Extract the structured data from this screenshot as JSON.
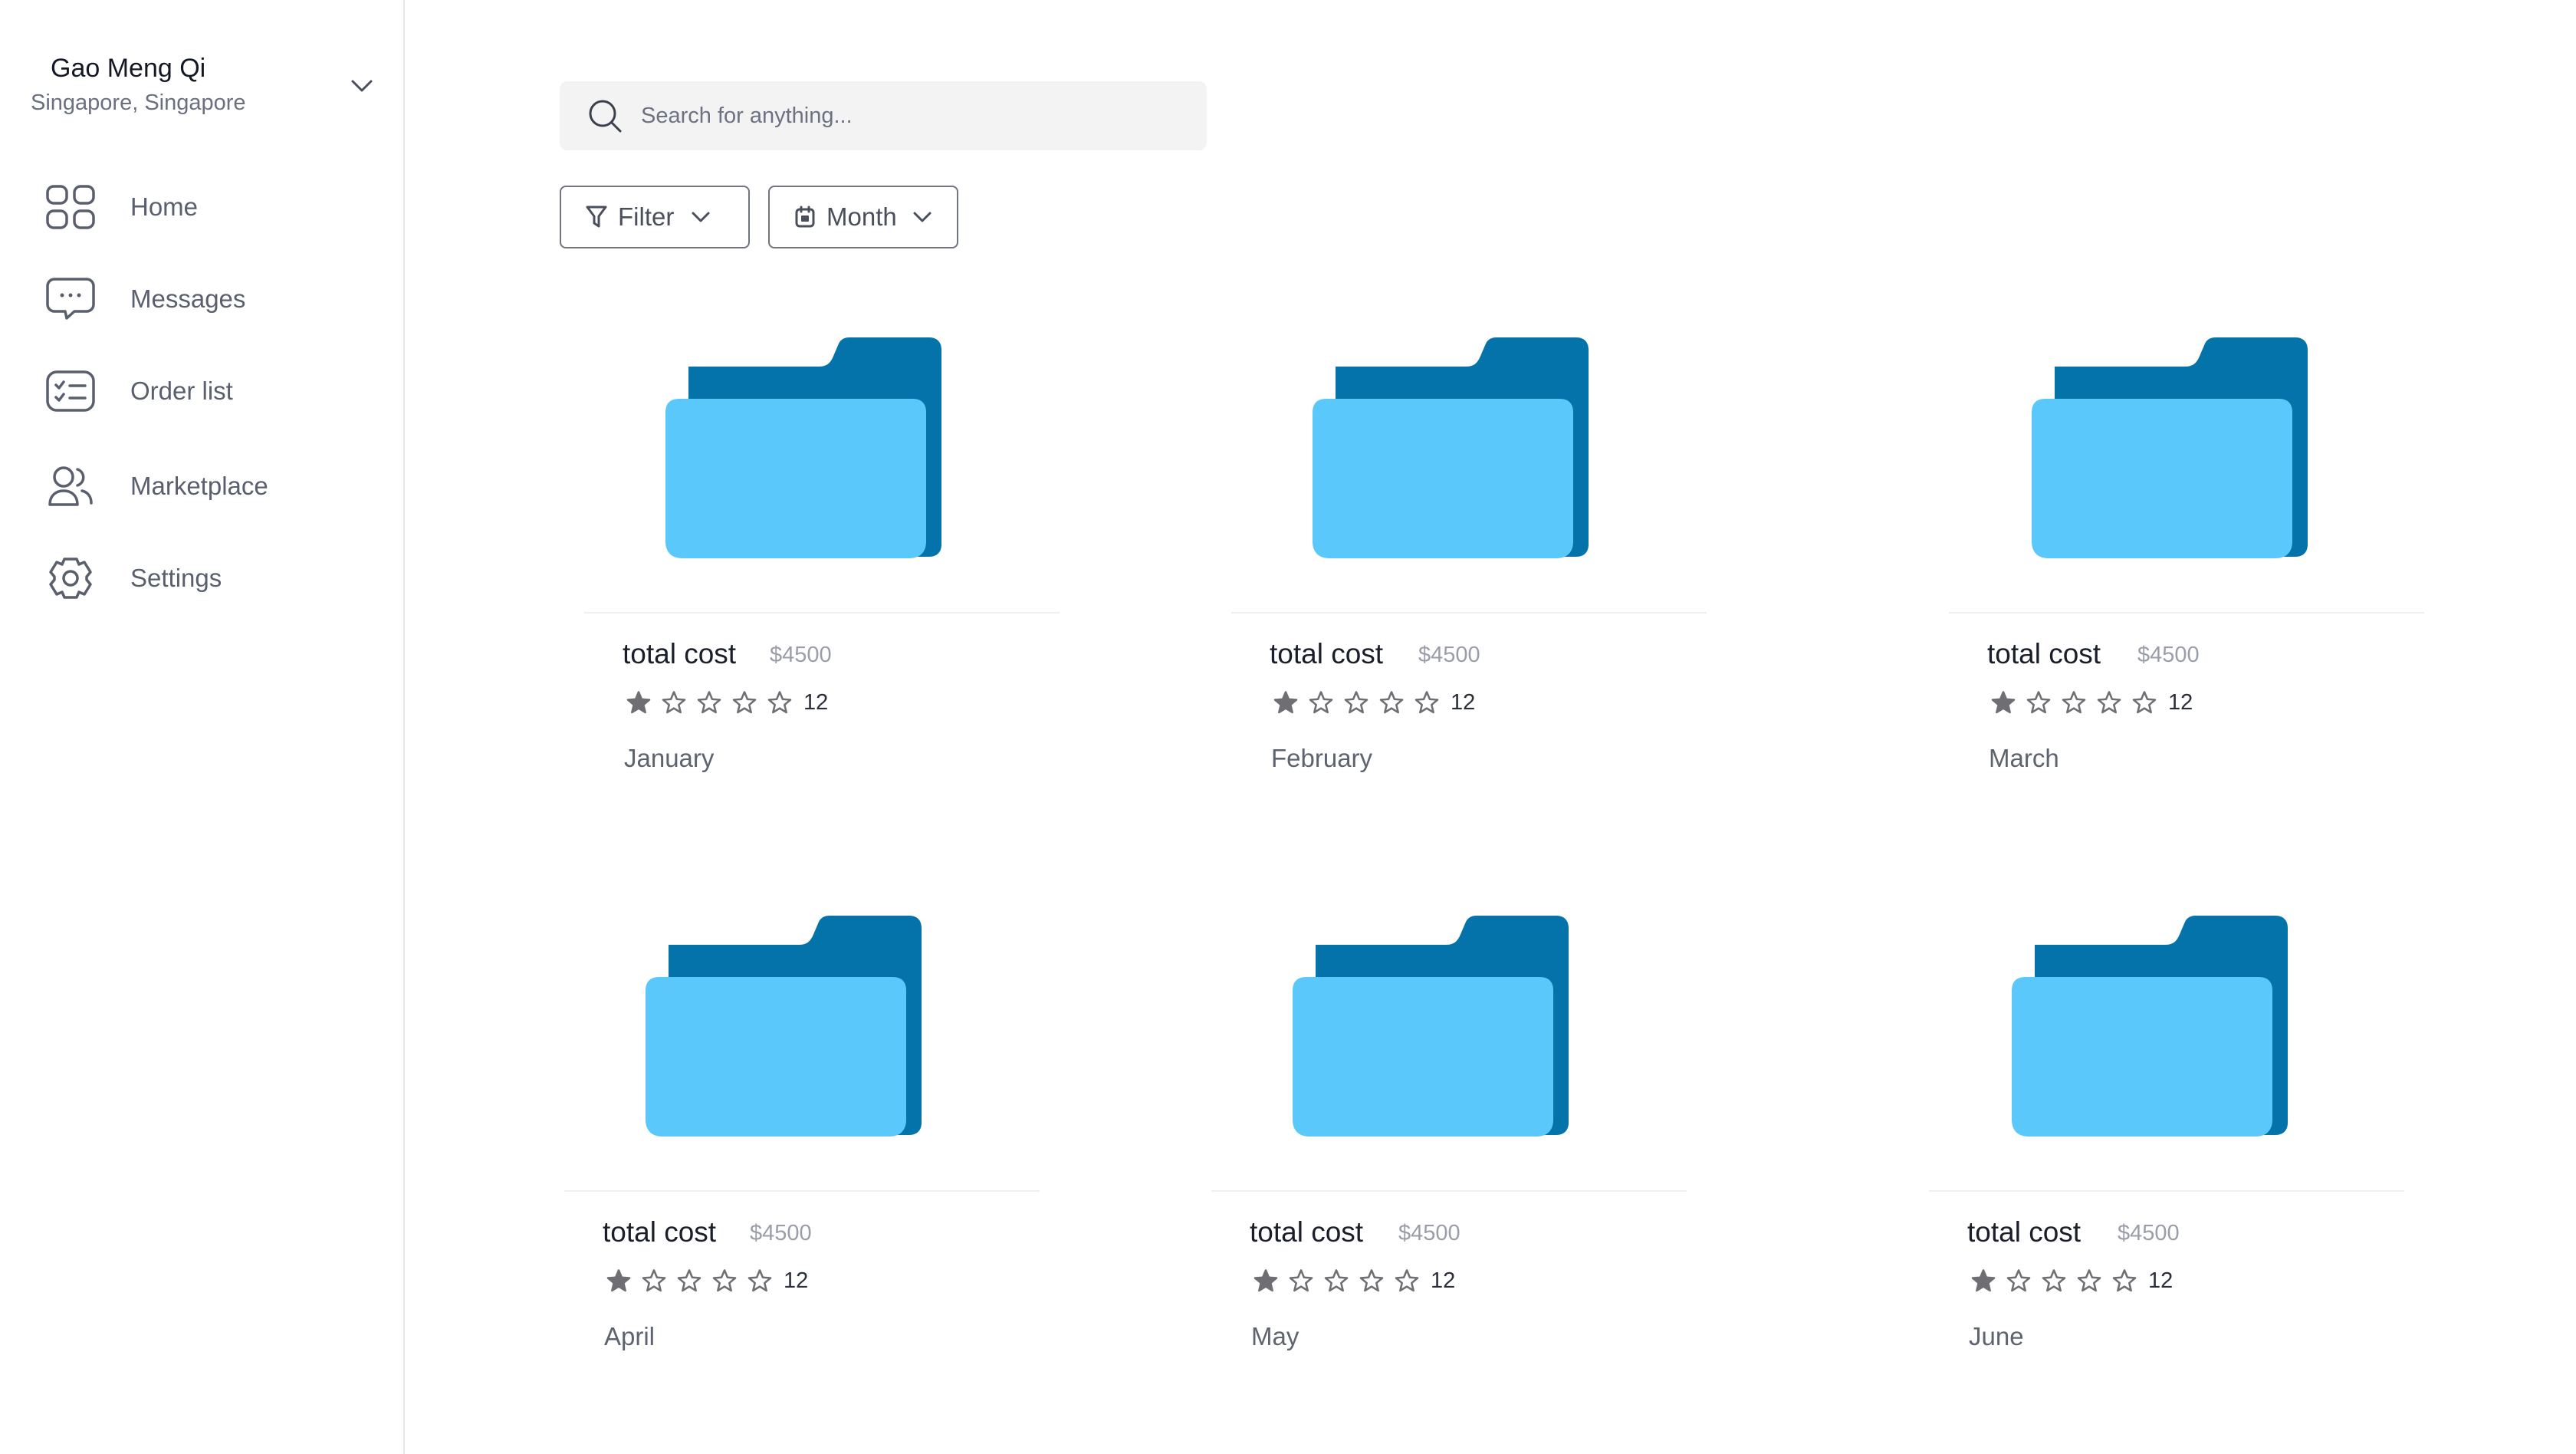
{
  "profile": {
    "name": "Gao Meng Qi",
    "location": "Singapore, Singapore"
  },
  "nav": [
    {
      "label": "Home",
      "icon": "grid-icon"
    },
    {
      "label": "Messages",
      "icon": "chat-icon"
    },
    {
      "label": "Order list",
      "icon": "checklist-icon"
    },
    {
      "label": "Marketplace",
      "icon": "users-icon"
    },
    {
      "label": "Settings",
      "icon": "gear-icon"
    }
  ],
  "search": {
    "placeholder": "Search for anything..."
  },
  "toolbar": {
    "filter_label": "Filter",
    "month_label": "Month"
  },
  "colors": {
    "folder_back": "#0373aa",
    "folder_front": "#5ac8fa",
    "star": "#6e6e73"
  },
  "cards": [
    {
      "title": "total cost",
      "price": "$4500",
      "rating": 1,
      "count": "12",
      "month": "January"
    },
    {
      "title": "total cost",
      "price": "$4500",
      "rating": 1,
      "count": "12",
      "month": "February"
    },
    {
      "title": "total cost",
      "price": "$4500",
      "rating": 1,
      "count": "12",
      "month": "March"
    },
    {
      "title": "total cost",
      "price": "$4500",
      "rating": 1,
      "count": "12",
      "month": "April"
    },
    {
      "title": "total cost",
      "price": "$4500",
      "rating": 1,
      "count": "12",
      "month": "May"
    },
    {
      "title": "total cost",
      "price": "$4500",
      "rating": 1,
      "count": "12",
      "month": "June"
    }
  ]
}
